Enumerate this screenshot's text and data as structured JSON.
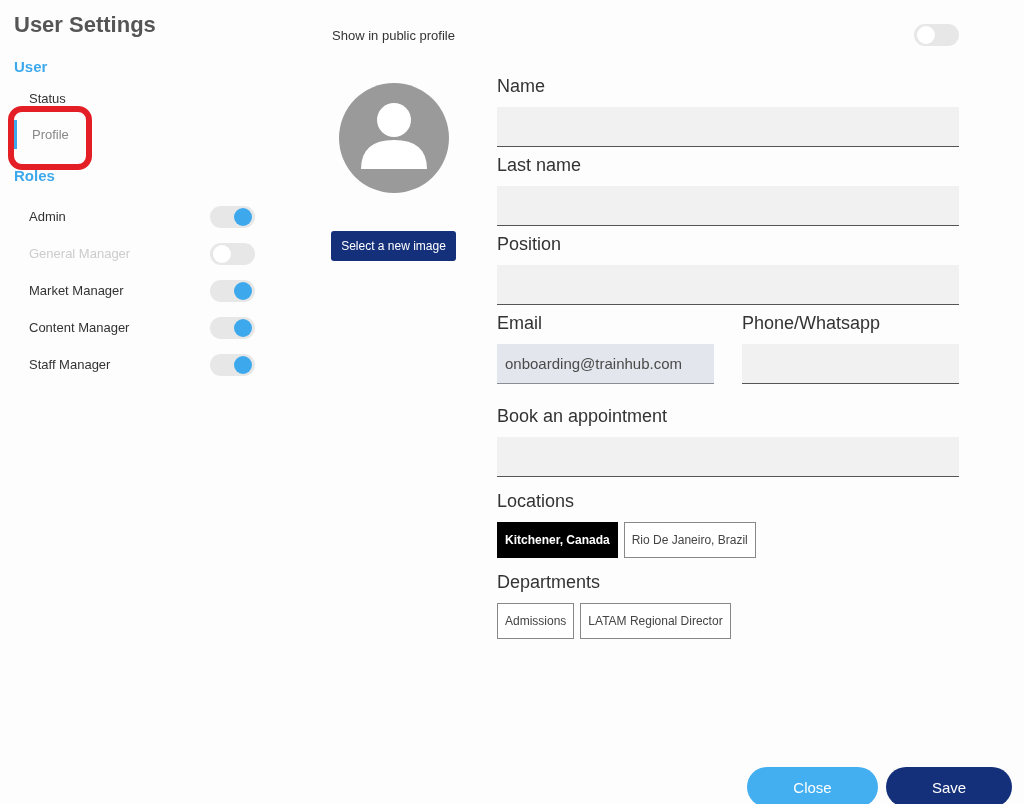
{
  "title": "User Settings",
  "sidebar": {
    "sections": [
      {
        "heading": "User",
        "kind": "nav",
        "items": [
          {
            "label": "Status",
            "selected": false
          },
          {
            "label": "Profile",
            "selected": true
          }
        ]
      },
      {
        "heading": "Roles",
        "kind": "toggles",
        "items": [
          {
            "label": "Admin",
            "on": true
          },
          {
            "label": "General Manager",
            "on": false
          },
          {
            "label": "Market Manager",
            "on": true
          },
          {
            "label": "Content Manager",
            "on": true
          },
          {
            "label": "Staff Manager",
            "on": true
          }
        ]
      }
    ]
  },
  "public_profile": {
    "label": "Show in public profile",
    "on": false
  },
  "image_button": "Select a new image",
  "form_rows": [
    {
      "fields": [
        {
          "label": "Name"
        }
      ]
    },
    {
      "fields": [
        {
          "label": "Last name"
        }
      ]
    },
    {
      "fields": [
        {
          "label": "Position"
        }
      ]
    },
    {
      "fields": [
        {
          "label": "Email",
          "value": "onboarding@trainhub.com",
          "disabled": true
        },
        {
          "label": "Phone/Whatsapp",
          "disabled": false
        }
      ]
    },
    {
      "fields": [
        {
          "label": "Book an appointment"
        }
      ]
    }
  ],
  "chip_groups": [
    {
      "label": "Locations",
      "chips": [
        {
          "label": "Kitchener, Canada",
          "selected": true
        },
        {
          "label": "Rio De Janeiro, Brazil",
          "selected": false
        }
      ]
    },
    {
      "label": "Departments",
      "chips": [
        {
          "label": "Admissions",
          "selected": false
        },
        {
          "label": "LATAM Regional Director",
          "selected": false
        }
      ]
    }
  ],
  "buttons": [
    {
      "label": "Close",
      "kind": "secondary"
    },
    {
      "label": "Save",
      "kind": "primary"
    }
  ]
}
